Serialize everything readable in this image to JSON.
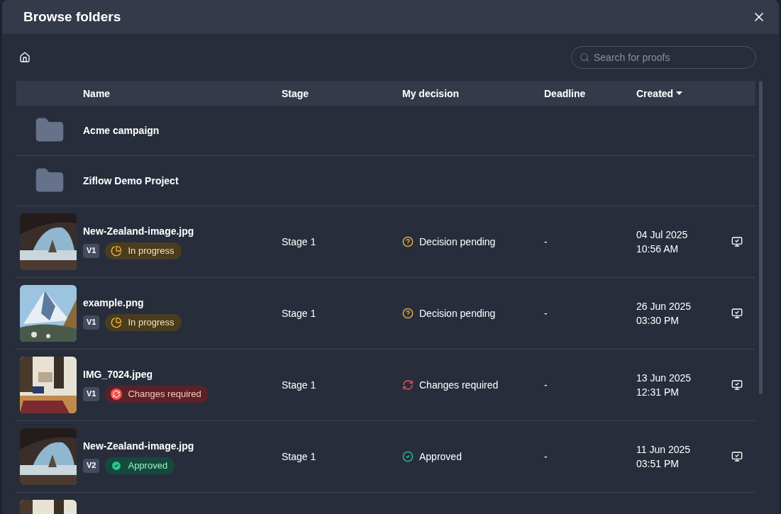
{
  "dialog": {
    "title": "Browse folders"
  },
  "search": {
    "placeholder": "Search for proofs"
  },
  "table": {
    "columns": [
      {
        "label": "Name",
        "sorted": false
      },
      {
        "label": "Stage",
        "sorted": false
      },
      {
        "label": "My decision",
        "sorted": false
      },
      {
        "label": "Deadline",
        "sorted": false
      },
      {
        "label": "Created",
        "sorted": true
      }
    ],
    "rows": [
      {
        "kind": "folder",
        "name": "Acme campaign"
      },
      {
        "kind": "folder",
        "name": "Ziflow Demo Project"
      },
      {
        "kind": "proof",
        "name": "New-Zealand-image.jpg",
        "version": "V1",
        "status": {
          "kind": "in_progress",
          "label": "In progress"
        },
        "stage": "Stage 1",
        "decision": {
          "kind": "pending",
          "label": "Decision pending"
        },
        "deadline": "-",
        "created_date": "04 Jul 2025",
        "created_time": "10:56 AM"
      },
      {
        "kind": "proof",
        "name": "example.png",
        "version": "V1",
        "status": {
          "kind": "in_progress",
          "label": "In progress"
        },
        "stage": "Stage 1",
        "decision": {
          "kind": "pending",
          "label": "Decision pending"
        },
        "deadline": "-",
        "created_date": "26 Jun 2025",
        "created_time": "03:30 PM"
      },
      {
        "kind": "proof",
        "name": "IMG_7024.jpeg",
        "version": "V1",
        "status": {
          "kind": "changes_required",
          "label": "Changes required"
        },
        "stage": "Stage 1",
        "decision": {
          "kind": "changes",
          "label": "Changes required"
        },
        "deadline": "-",
        "created_date": "13 Jun 2025",
        "created_time": "12:31 PM"
      },
      {
        "kind": "proof",
        "name": "New-Zealand-image.jpg",
        "version": "V2",
        "status": {
          "kind": "approved",
          "label": "Approved"
        },
        "stage": "Stage 1",
        "decision": {
          "kind": "approved",
          "label": "Approved"
        },
        "deadline": "-",
        "created_date": "11 Jun 2025",
        "created_time": "03:51 PM"
      },
      {
        "kind": "partial"
      }
    ]
  }
}
